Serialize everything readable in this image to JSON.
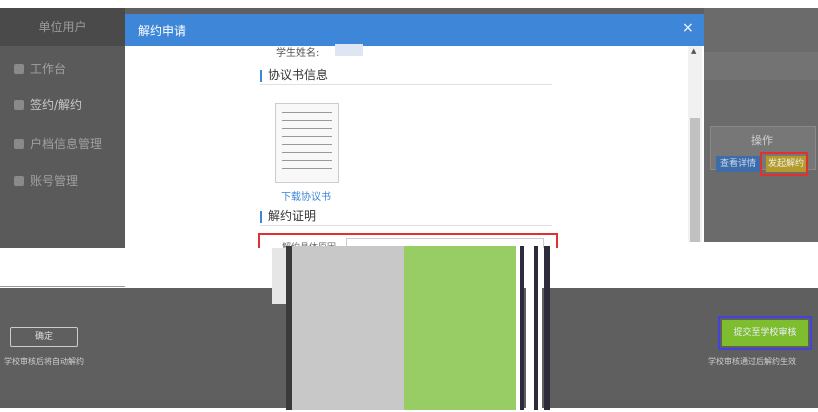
{
  "sidebar": {
    "header": "单位用户",
    "items": [
      {
        "label": "工作台"
      },
      {
        "label": "签约/解约"
      },
      {
        "label": "户档信息管理"
      },
      {
        "label": "账号管理"
      }
    ]
  },
  "table": {
    "operation_header": "操作",
    "view_detail_button": "查看详情",
    "cancel_contract_button": "发起解约"
  },
  "modal": {
    "title": "解约申请",
    "close": "×",
    "student_name_label": "学生姓名:",
    "agreement_section": "协议书信息",
    "download_link": "下载协议书",
    "proof_section": "解约证明",
    "reason_label": "解约具体原因"
  },
  "footer": {
    "left_button": "确定",
    "left_note": "学校审核后将自动解约",
    "submit_button": "提交至学校审核",
    "right_note": "学校审核通过后解约生效"
  }
}
